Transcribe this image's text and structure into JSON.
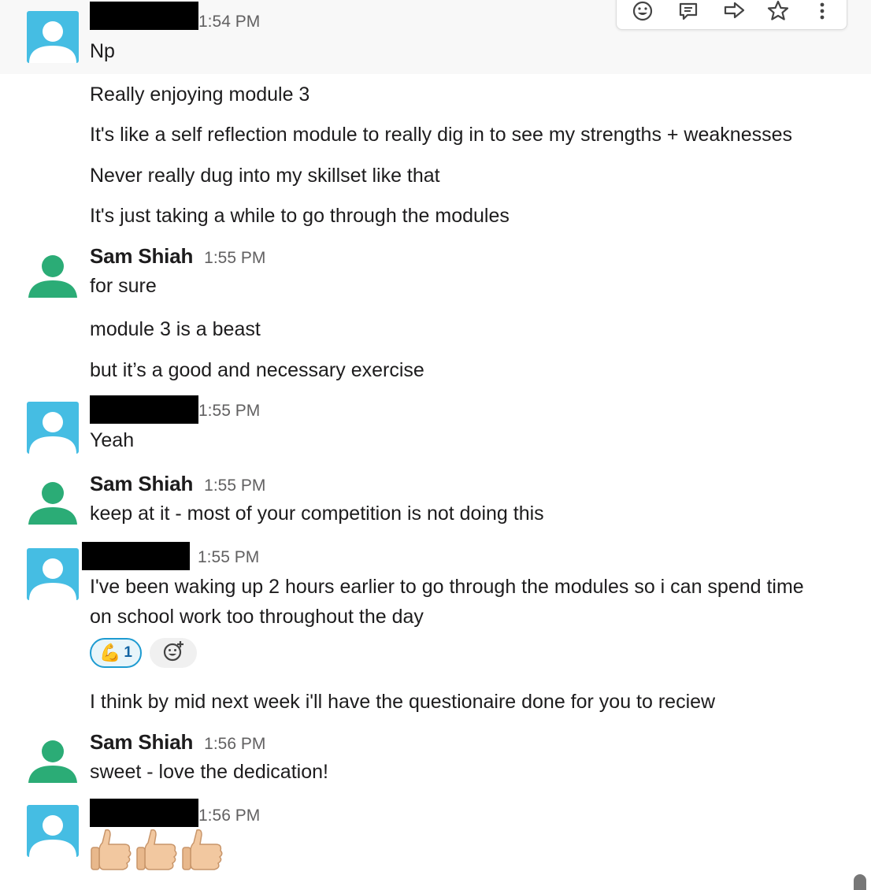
{
  "colors": {
    "accent_link": "#1264a3",
    "avatar_blue": "#45bde3",
    "avatar_green": "#2bac76",
    "text_primary": "#1d1c1d",
    "text_muted": "#616061",
    "reaction_border": "#1d9bd1"
  },
  "hover_toolbar": {
    "icons": [
      "add-reaction-icon",
      "reply-in-thread-icon",
      "share-message-icon",
      "save-star-icon",
      "more-actions-icon"
    ]
  },
  "messages": [
    {
      "sender": "",
      "time": "1:54 PM",
      "lines": [
        "Np",
        "Really enjoying module 3",
        "It's like a self reflection module to really dig in to see my strengths + weaknesses",
        "Never really dug into my skillset like that",
        "It's just taking a while to go through the modules"
      ]
    },
    {
      "sender": "Sam Shiah",
      "time": "1:55 PM",
      "lines": [
        "for sure",
        "module 3 is a beast",
        "but it’s a good and necessary exercise"
      ]
    },
    {
      "sender": "",
      "time": "1:55 PM",
      "lines": [
        "Yeah"
      ]
    },
    {
      "sender": "Sam Shiah",
      "time": "1:55 PM",
      "lines": [
        "keep at it - most of your competition is not doing this"
      ]
    },
    {
      "sender": "",
      "time": "1:55 PM",
      "lines": [
        "I've been waking up 2 hours earlier to go through the modules so i can spend time",
        "on school work too throughout the day",
        "I think by mid next week i'll have the questionaire done for you to reciew"
      ]
    },
    {
      "sender": "Sam Shiah",
      "time": "1:56 PM",
      "lines": [
        "sweet - love the dedication!"
      ]
    },
    {
      "sender": "",
      "time": "1:56 PM",
      "lines": [
        "👍🏼👍🏼👍🏼"
      ]
    }
  ],
  "reaction": {
    "emoji": "💪",
    "count": "1",
    "icon": "flexed-biceps-emoji"
  },
  "add_reaction_icon": "add-reaction-icon",
  "thumbs_icon": "thumbs-up-emoji"
}
